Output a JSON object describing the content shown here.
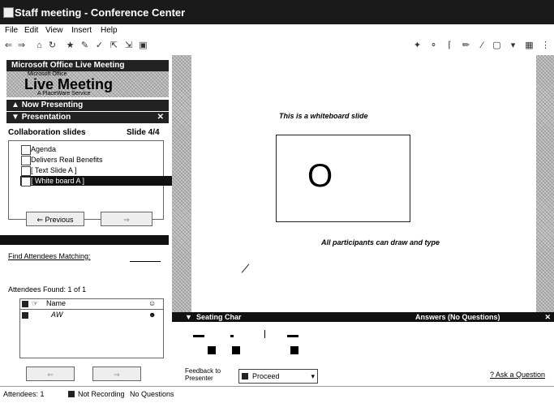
{
  "window": {
    "title": "Staff meeting - Conference Center"
  },
  "menu": [
    "File",
    "Edit",
    "View",
    "Insert",
    "Help"
  ],
  "panel": {
    "header": "Microsoft Office Live Meeting",
    "logo": {
      "small": "Microsoft Office",
      "big": "Live Meeting",
      "sub": "A PlaceWare Service"
    },
    "now_presenting": "Now Presenting",
    "presentation": "Presentation",
    "slides_label": "Collaboration slides",
    "slide_counter": "Slide 4/4",
    "slides": [
      "Agenda",
      "Delivers Real Benefits",
      "[ Text Slide A ]",
      "[ White board A ]"
    ],
    "previous": "Previous",
    "find_label": "Find Attendees Matching:",
    "attendees_found": "Attendees Found: 1 of 1",
    "col_name": "Name",
    "attendee": "AW"
  },
  "whiteboard": {
    "title": "This is a whiteboard slide",
    "shape_text": "O",
    "caption": "All participants can draw and type"
  },
  "bottom": {
    "seating": "Seating Char",
    "answers": "Answers (No Questions)",
    "feedback_label": "Feedback to Presenter",
    "feedback_value": "Proceed",
    "ask": "Ask a Question"
  },
  "status": {
    "attendees": "Attendees: 1",
    "recording": "Not Recording",
    "questions": "No Questions"
  }
}
